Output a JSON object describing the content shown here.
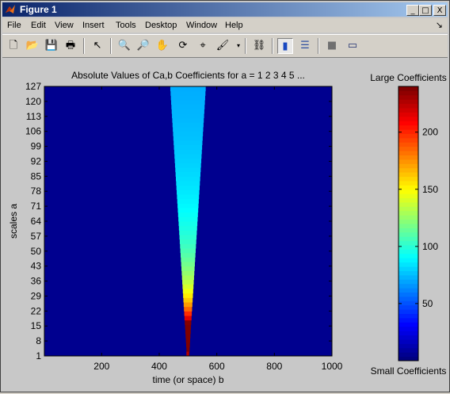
{
  "window": {
    "title": "Figure 1",
    "controls": [
      "_",
      "□",
      "X"
    ]
  },
  "menu": {
    "items": [
      "File",
      "Edit",
      "View",
      "Insert",
      "Tools",
      "Desktop",
      "Window",
      "Help"
    ],
    "dock_glyph": "↘"
  },
  "toolbar": {
    "buttons": [
      {
        "name": "new-figure-icon",
        "glyph": "🗋"
      },
      {
        "name": "open-file-icon",
        "glyph": "📂"
      },
      {
        "name": "save-icon",
        "glyph": "💾"
      },
      {
        "name": "print-icon",
        "glyph": "🖶"
      },
      {
        "name": "select-arrow-icon",
        "glyph": "↖"
      },
      {
        "name": "zoom-in-icon",
        "glyph": "🔍"
      },
      {
        "name": "zoom-out-icon",
        "glyph": "🔎"
      },
      {
        "name": "pan-hand-icon",
        "glyph": "✋"
      },
      {
        "name": "rotate-3d-icon",
        "glyph": "⟳"
      },
      {
        "name": "data-cursor-icon",
        "glyph": "⌖"
      },
      {
        "name": "brush-icon",
        "glyph": "🖌"
      },
      {
        "name": "link-plot-icon",
        "glyph": "⛓"
      },
      {
        "name": "colorbar-icon",
        "glyph": "▮"
      },
      {
        "name": "legend-icon",
        "glyph": "☰"
      },
      {
        "name": "hide-plot-tools-icon",
        "glyph": "■"
      },
      {
        "name": "show-plot-tools-icon",
        "glyph": "▭"
      }
    ]
  },
  "colors": {
    "plot_background": "#00008f",
    "figure_background": "#c8c8c8"
  },
  "chart_data": {
    "type": "heatmap",
    "title": "Absolute Values of Ca,b Coefficients for a =  1 2 3 4 5 ...",
    "xlabel": "time (or space) b",
    "ylabel": "scales a",
    "xlim": [
      1,
      1000
    ],
    "ylim": [
      1,
      127
    ],
    "xticks": [
      200,
      400,
      600,
      800,
      1000
    ],
    "yticks": [
      1,
      8,
      15,
      22,
      29,
      36,
      43,
      50,
      57,
      64,
      71,
      78,
      85,
      92,
      99,
      106,
      113,
      120,
      127
    ],
    "colormap": "jet",
    "colorbar": {
      "top_label": "Large Coefficients",
      "bottom_label": "Small Coefficients",
      "range": [
        0,
        240
      ],
      "ticks": [
        50,
        100,
        150,
        200
      ]
    },
    "feature": {
      "description_center_b": 500,
      "cone_half_width_at_top_b": 62,
      "peak_value": 240,
      "background_value": 0
    }
  }
}
